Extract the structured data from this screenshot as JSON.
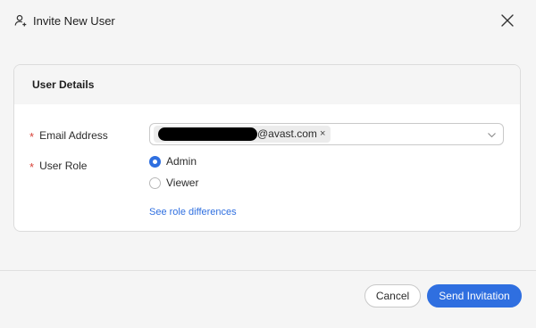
{
  "dialog": {
    "title": "Invite New User",
    "header_icon": "user-add-icon",
    "close_icon": "close-icon"
  },
  "user_details": {
    "section_title": "User Details",
    "email": {
      "label": "Email Address",
      "required_marker": "*",
      "chips": [
        {
          "text": "@avast.com",
          "remove": "×",
          "redacted": true
        }
      ],
      "dropdown_icon": "chevron-down-icon"
    },
    "role": {
      "label": "User Role",
      "required_marker": "*",
      "options": [
        {
          "label": "Admin",
          "checked": true
        },
        {
          "label": "Viewer",
          "checked": false
        }
      ],
      "link": "See role differences"
    }
  },
  "footer": {
    "cancel_label": "Cancel",
    "send_label": "Send Invitation"
  },
  "colors": {
    "accent": "#2f6fe0",
    "required": "#d8443a",
    "background": "#f5f5f5",
    "card": "#ffffff"
  }
}
